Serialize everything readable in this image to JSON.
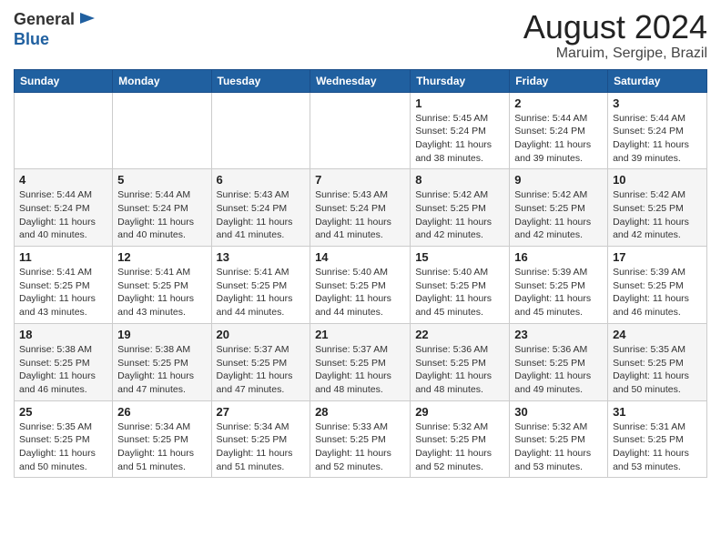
{
  "header": {
    "logo_general": "General",
    "logo_blue": "Blue",
    "title": "August 2024",
    "subtitle": "Maruim, Sergipe, Brazil"
  },
  "calendar": {
    "days_of_week": [
      "Sunday",
      "Monday",
      "Tuesday",
      "Wednesday",
      "Thursday",
      "Friday",
      "Saturday"
    ],
    "weeks": [
      [
        {
          "day": "",
          "info": ""
        },
        {
          "day": "",
          "info": ""
        },
        {
          "day": "",
          "info": ""
        },
        {
          "day": "",
          "info": ""
        },
        {
          "day": "1",
          "info": "Sunrise: 5:45 AM\nSunset: 5:24 PM\nDaylight: 11 hours\nand 38 minutes."
        },
        {
          "day": "2",
          "info": "Sunrise: 5:44 AM\nSunset: 5:24 PM\nDaylight: 11 hours\nand 39 minutes."
        },
        {
          "day": "3",
          "info": "Sunrise: 5:44 AM\nSunset: 5:24 PM\nDaylight: 11 hours\nand 39 minutes."
        }
      ],
      [
        {
          "day": "4",
          "info": "Sunrise: 5:44 AM\nSunset: 5:24 PM\nDaylight: 11 hours\nand 40 minutes."
        },
        {
          "day": "5",
          "info": "Sunrise: 5:44 AM\nSunset: 5:24 PM\nDaylight: 11 hours\nand 40 minutes."
        },
        {
          "day": "6",
          "info": "Sunrise: 5:43 AM\nSunset: 5:24 PM\nDaylight: 11 hours\nand 41 minutes."
        },
        {
          "day": "7",
          "info": "Sunrise: 5:43 AM\nSunset: 5:24 PM\nDaylight: 11 hours\nand 41 minutes."
        },
        {
          "day": "8",
          "info": "Sunrise: 5:42 AM\nSunset: 5:25 PM\nDaylight: 11 hours\nand 42 minutes."
        },
        {
          "day": "9",
          "info": "Sunrise: 5:42 AM\nSunset: 5:25 PM\nDaylight: 11 hours\nand 42 minutes."
        },
        {
          "day": "10",
          "info": "Sunrise: 5:42 AM\nSunset: 5:25 PM\nDaylight: 11 hours\nand 42 minutes."
        }
      ],
      [
        {
          "day": "11",
          "info": "Sunrise: 5:41 AM\nSunset: 5:25 PM\nDaylight: 11 hours\nand 43 minutes."
        },
        {
          "day": "12",
          "info": "Sunrise: 5:41 AM\nSunset: 5:25 PM\nDaylight: 11 hours\nand 43 minutes."
        },
        {
          "day": "13",
          "info": "Sunrise: 5:41 AM\nSunset: 5:25 PM\nDaylight: 11 hours\nand 44 minutes."
        },
        {
          "day": "14",
          "info": "Sunrise: 5:40 AM\nSunset: 5:25 PM\nDaylight: 11 hours\nand 44 minutes."
        },
        {
          "day": "15",
          "info": "Sunrise: 5:40 AM\nSunset: 5:25 PM\nDaylight: 11 hours\nand 45 minutes."
        },
        {
          "day": "16",
          "info": "Sunrise: 5:39 AM\nSunset: 5:25 PM\nDaylight: 11 hours\nand 45 minutes."
        },
        {
          "day": "17",
          "info": "Sunrise: 5:39 AM\nSunset: 5:25 PM\nDaylight: 11 hours\nand 46 minutes."
        }
      ],
      [
        {
          "day": "18",
          "info": "Sunrise: 5:38 AM\nSunset: 5:25 PM\nDaylight: 11 hours\nand 46 minutes."
        },
        {
          "day": "19",
          "info": "Sunrise: 5:38 AM\nSunset: 5:25 PM\nDaylight: 11 hours\nand 47 minutes."
        },
        {
          "day": "20",
          "info": "Sunrise: 5:37 AM\nSunset: 5:25 PM\nDaylight: 11 hours\nand 47 minutes."
        },
        {
          "day": "21",
          "info": "Sunrise: 5:37 AM\nSunset: 5:25 PM\nDaylight: 11 hours\nand 48 minutes."
        },
        {
          "day": "22",
          "info": "Sunrise: 5:36 AM\nSunset: 5:25 PM\nDaylight: 11 hours\nand 48 minutes."
        },
        {
          "day": "23",
          "info": "Sunrise: 5:36 AM\nSunset: 5:25 PM\nDaylight: 11 hours\nand 49 minutes."
        },
        {
          "day": "24",
          "info": "Sunrise: 5:35 AM\nSunset: 5:25 PM\nDaylight: 11 hours\nand 50 minutes."
        }
      ],
      [
        {
          "day": "25",
          "info": "Sunrise: 5:35 AM\nSunset: 5:25 PM\nDaylight: 11 hours\nand 50 minutes."
        },
        {
          "day": "26",
          "info": "Sunrise: 5:34 AM\nSunset: 5:25 PM\nDaylight: 11 hours\nand 51 minutes."
        },
        {
          "day": "27",
          "info": "Sunrise: 5:34 AM\nSunset: 5:25 PM\nDaylight: 11 hours\nand 51 minutes."
        },
        {
          "day": "28",
          "info": "Sunrise: 5:33 AM\nSunset: 5:25 PM\nDaylight: 11 hours\nand 52 minutes."
        },
        {
          "day": "29",
          "info": "Sunrise: 5:32 AM\nSunset: 5:25 PM\nDaylight: 11 hours\nand 52 minutes."
        },
        {
          "day": "30",
          "info": "Sunrise: 5:32 AM\nSunset: 5:25 PM\nDaylight: 11 hours\nand 53 minutes."
        },
        {
          "day": "31",
          "info": "Sunrise: 5:31 AM\nSunset: 5:25 PM\nDaylight: 11 hours\nand 53 minutes."
        }
      ]
    ]
  }
}
